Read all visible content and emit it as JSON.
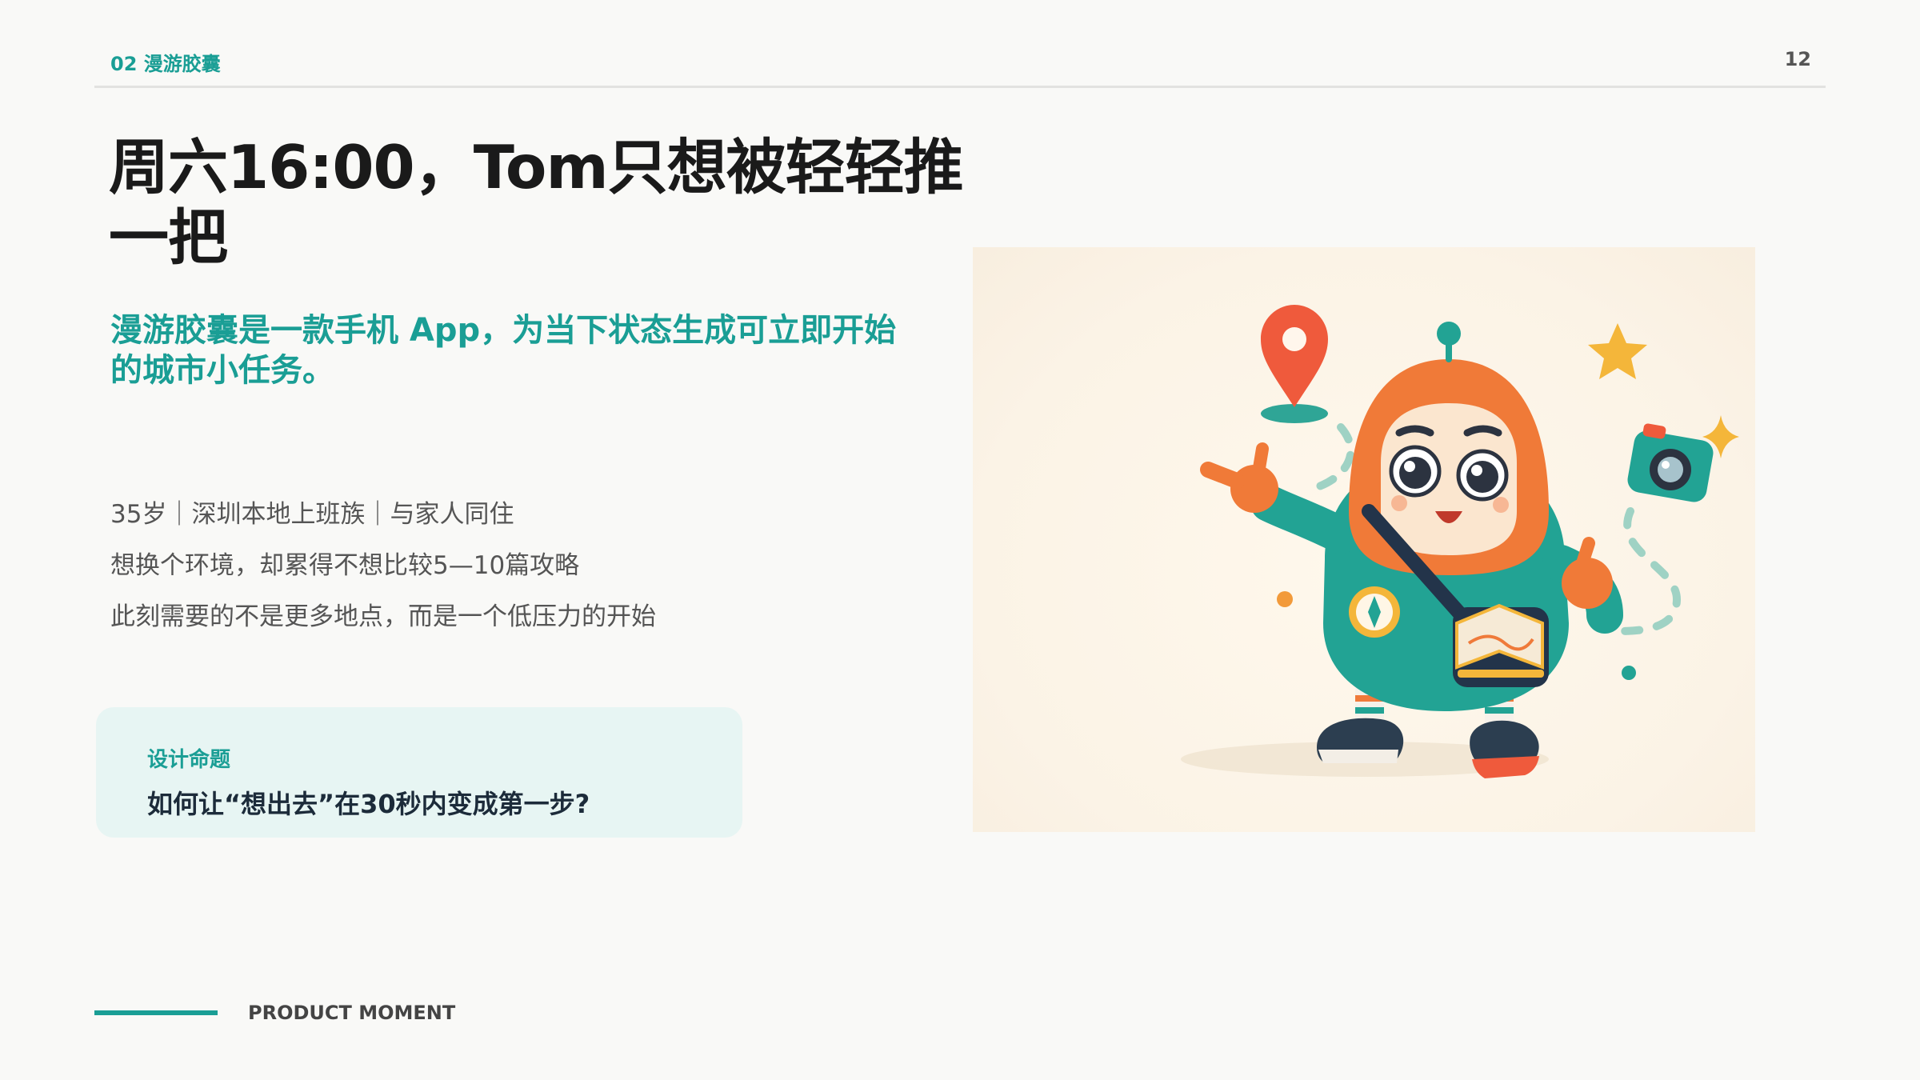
{
  "header": {
    "section": "02 漫游胶囊",
    "page_number": "12"
  },
  "title": "周六16:00，Tom只想被轻轻推一把",
  "tagline": "漫游胶囊是一款手机 App，为当下状态生成可立即开始的城市小任务。",
  "persona": {
    "lines": [
      "35岁｜深圳本地上班族｜与家人同住",
      "想换个环境，却累得不想比较5—10篇攻略",
      "此刻需要的不是更多地点，而是一个低压力的开始"
    ]
  },
  "question_card": {
    "label": "设计命题",
    "question": "如何让“想出去”在30秒内变成第一步?"
  },
  "footer": {
    "label": "PRODUCT MOMENT"
  },
  "colors": {
    "accent": "#1a9e95",
    "body_text": "#555555",
    "title_text": "#1a1a1a",
    "card_bg": "#e7f5f3",
    "mascot_orange": "#f07a38",
    "mascot_teal": "#22a394"
  },
  "illustration": {
    "subject": "mascot-character",
    "icons": [
      "location-pin-icon",
      "star-icon",
      "camera-icon",
      "sparkle-icon",
      "compass-icon",
      "map-bag-icon"
    ]
  }
}
